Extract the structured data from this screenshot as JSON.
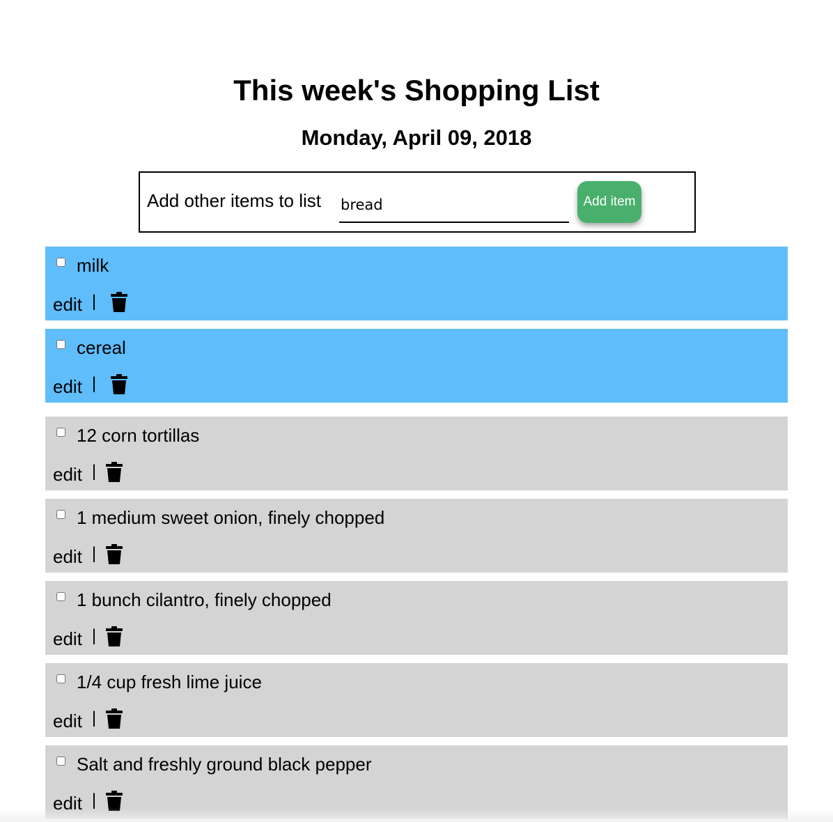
{
  "header": {
    "title": "This week's Shopping List",
    "date": "Monday, April 09, 2018"
  },
  "add_form": {
    "label": "Add other items to list",
    "input_value": "bread",
    "button_label": "Add item"
  },
  "actions": {
    "edit_label": "edit",
    "separator": "|",
    "delete_icon": "trash-icon"
  },
  "colors": {
    "checked_row": "#5fbdfb",
    "unchecked_row": "#d4d4d4",
    "add_button": "#48b06c"
  },
  "lists": {
    "highlighted": [
      {
        "name": "milk",
        "checked": false
      },
      {
        "name": "cereal",
        "checked": false
      }
    ],
    "items": [
      {
        "name": "12 corn tortillas",
        "checked": false
      },
      {
        "name": "1 medium sweet onion, finely chopped",
        "checked": false
      },
      {
        "name": "1 bunch cilantro, finely chopped",
        "checked": false
      },
      {
        "name": "1/4 cup fresh lime juice",
        "checked": false
      },
      {
        "name": "Salt and freshly ground black pepper",
        "checked": false
      }
    ]
  }
}
